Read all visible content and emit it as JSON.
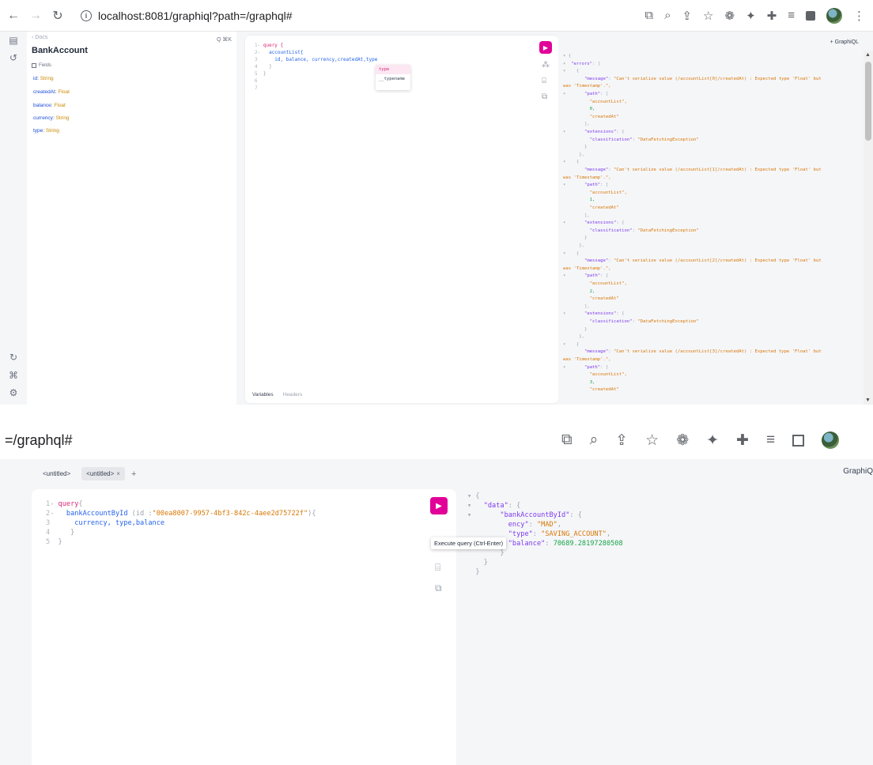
{
  "top": {
    "browser": {
      "url": "localhost:8081/graphiql?path=/graphql#"
    },
    "docs": {
      "back_label": "‹ Docs",
      "title": "BankAccount",
      "search_hint": "Q ⌘K",
      "fields_label": "Fields",
      "fields": [
        {
          "name": "id",
          "type": "String"
        },
        {
          "name": "createdAt",
          "type": "Float"
        },
        {
          "name": "balance",
          "type": "Float"
        },
        {
          "name": "currency",
          "type": "String"
        },
        {
          "name": "type",
          "type": "String"
        }
      ]
    },
    "editor": {
      "lines": [
        {
          "num": "1",
          "text": "query {"
        },
        {
          "num": "2",
          "text": "  accountList{"
        },
        {
          "num": "3",
          "text": "    id, balance, currency,createdAt,type"
        },
        {
          "num": "4",
          "text": "  }"
        },
        {
          "num": "5",
          "text": "}"
        },
        {
          "num": "6",
          "text": ""
        },
        {
          "num": "7",
          "text": ""
        }
      ],
      "autocomplete": [
        "type",
        "__typename"
      ],
      "tabs": {
        "variables": "Variables",
        "headers": "Headers"
      }
    },
    "result": {
      "graphiql_label": "+   GraphiQL",
      "errors_key": "\"errors\"",
      "messages": [
        "\"Can't serialize value (/accountList[0]/createdAt) : Expected type 'Float' but",
        "\"Can't serialize value (/accountList[1]/createdAt) : Expected type 'Float' but",
        "\"Can't serialize value (/accountList[2]/createdAt) : Expected type 'Float' but",
        "\"Can't serialize value (/accountList[3]/createdAt) : Expected type 'Float' but"
      ],
      "was_line": "was 'Timestamp'.\",",
      "path_key": "\"path\"",
      "account_list": "\"accountList\",",
      "indices": [
        "0,",
        "1,",
        "2,",
        "3,"
      ],
      "created_at": "\"createdAt\"",
      "extensions_key": "\"extensions\"",
      "classification_key": "\"classification\"",
      "classification_val": "\"DataFetchingException\"",
      "message_key": "\"message\""
    }
  },
  "bottom": {
    "url_fragment": "=/graphql#",
    "tabs": [
      {
        "label": "<untitled>",
        "active": false
      },
      {
        "label": "<untitled>",
        "active": true
      }
    ],
    "graphiql_label": "GraphiQ",
    "editor_lines": [
      {
        "num": "1",
        "kw": "query",
        "rest": "{"
      },
      {
        "num": "2",
        "field": "bankAccountById",
        "rest": " (id :",
        "str": "\"00ea8007-9957-4bf3-842c-4aee2d75722f\"",
        "tail": "){"
      },
      {
        "num": "3",
        "field": "currency, type,balance"
      },
      {
        "num": "4",
        "rest": "}"
      },
      {
        "num": "5",
        "rest": "}"
      }
    ],
    "tooltip": "Execute query (Ctrl-Enter)",
    "result": {
      "data_key": "\"data\"",
      "bank_key": "\"bankAccountById\"",
      "currency_key_visible": "ency\"",
      "currency_val": "\"MAD\"",
      "type_key": "\"type\"",
      "type_val": "\"SAVING_ACCOUNT\"",
      "balance_key": "\"balance\"",
      "balance_val": "70689.28197280508"
    }
  }
}
